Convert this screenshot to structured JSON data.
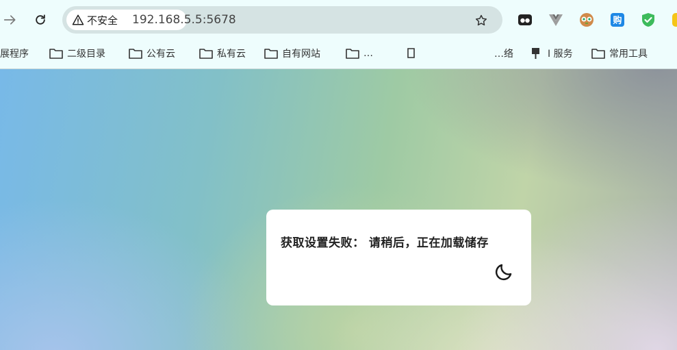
{
  "browser": {
    "security_label": "不安全",
    "url": "192.168.5.5:5678",
    "extensions": [
      {
        "name": "eyes-extension-icon",
        "color": "#222222"
      },
      {
        "name": "vue-devtools-icon",
        "color": "#9e9e9e"
      },
      {
        "name": "owl-extension-icon",
        "color": "#d08a4a"
      },
      {
        "name": "shopping-extension-icon",
        "color": "#1e88e5"
      },
      {
        "name": "shield-extension-icon",
        "color": "#3dbb5c"
      },
      {
        "name": "yellow-extension-icon",
        "color": "#f5c518"
      }
    ]
  },
  "bookmarks": {
    "items": [
      {
        "label": "展程序"
      },
      {
        "label": "二级目录"
      },
      {
        "label": "公有云"
      },
      {
        "label": "私有云"
      },
      {
        "label": "自有网站"
      },
      {
        "label": "…"
      },
      {
        "label": ""
      },
      {
        "label": "…络"
      },
      {
        "label": "I 服务"
      },
      {
        "label": "常用工具"
      }
    ]
  },
  "dialog": {
    "message": "获取设置失败： 请稍后，正在加载储存"
  },
  "colors": {
    "chrome_bg": "#eefdfd",
    "omnibox_bg": "#d5e3e3",
    "dialog_bg": "#ffffff"
  }
}
